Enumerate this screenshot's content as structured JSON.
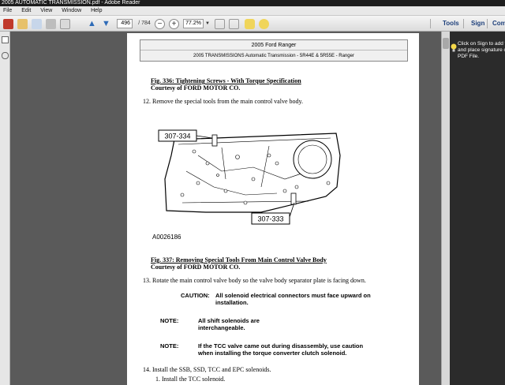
{
  "window": {
    "title": "2005 AUTOMATIC TRANSMISSION.pdf - Adobe Reader"
  },
  "menu": [
    "File",
    "Edit",
    "View",
    "Window",
    "Help"
  ],
  "toolbar": {
    "page_number": "496",
    "page_total": "/ 784",
    "zoom": "77.2%",
    "tools_label": "Tools",
    "sign_label": "Sign",
    "comment_label": "Comment"
  },
  "sign_panel": {
    "message_lines": [
      "Click on Sign to add te",
      "and place signature on",
      "PDF File."
    ]
  },
  "document": {
    "header_title": "2005 Ford Ranger",
    "header_subtitle": "2005 TRANSMISSIONS Automatic Transmission - 5R44E & 5R55E - Ranger",
    "fig336_title": "Fig. 336: Tightening Screws - With Torque Specification",
    "fig336_courtesy": "Courtesy of FORD MOTOR CO.",
    "step12": "12.   Remove the special tools from the main control valve body.",
    "callout_a": "307-334",
    "callout_b": "307-333",
    "figure_id": "A0026186",
    "fig337_title": "Fig. 337: Removing Special Tools From Main Control Valve Body",
    "fig337_courtesy": "Courtesy of FORD MOTOR CO.",
    "step13": "13.   Rotate the main control valve body so the valve body separator plate is facing down.",
    "caution_label": "CAUTION:",
    "caution_text_1": "All solenoid electrical connectors must face upward on",
    "caution_text_2": "installation.",
    "note1_label": "NOTE:",
    "note1_text_1": "All shift solenoids are",
    "note1_text_2": "interchangeable.",
    "note2_label": "NOTE:",
    "note2_text_1": "If the TCC valve came out during disassembly, use caution",
    "note2_text_2": "when installing the torque converter clutch solenoid.",
    "step14": "14.   Install the SSB, SSD, TCC and EPC solenoids.",
    "step14_1": "1.   Install the TCC solenoid."
  },
  "colors": {
    "accent": "#1d3f7a",
    "background": "#5a5a5a"
  }
}
